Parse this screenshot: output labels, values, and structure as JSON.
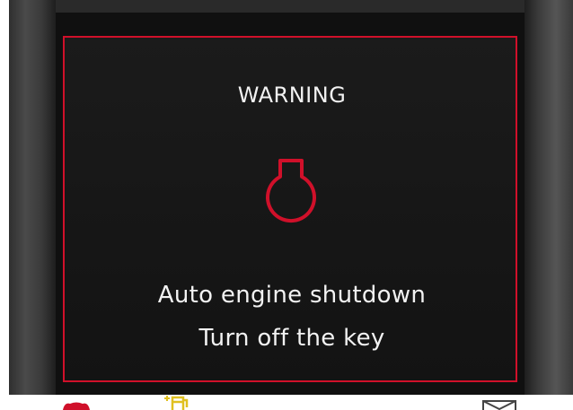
{
  "warning": {
    "title": "WARNING",
    "line1": "Auto engine shutdown",
    "line2": "Turn off the key",
    "icon": "engine-oil-pressure-icon"
  },
  "status_strip": {
    "icons": [
      "red-warning-icon",
      "fuel-pump-icon",
      "envelope-icon"
    ]
  },
  "colors": {
    "accent": "#d0102a",
    "text": "#f2f2f2",
    "background": "#161616",
    "fuel_icon": "#e0c020"
  }
}
